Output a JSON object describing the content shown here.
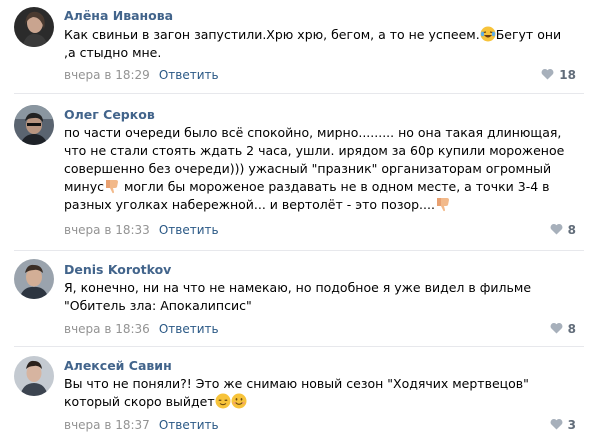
{
  "comments": [
    {
      "author": "Алёна Иванова",
      "lines": [
        "Как свиньи в загон запустили.Хрю хрю, бегом, а то не успеем.",
        "Бегут они",
        ",а стыдно мне."
      ],
      "time": "вчера в 18:29",
      "reply": "Ответить",
      "likes": "18",
      "emoji": [
        "laughing-crying"
      ]
    },
    {
      "author": "Олег Серков",
      "lines": [
        "по части очереди было всё спокойно, мирно......... но она такая длинющая,",
        "что не стали стоять ждать 2 часа, ушли. ирядом за 60р купили мороженое",
        "совершенно без очереди))) ужасный \"празник\" организаторам огромный",
        "минус",
        " могли бы мороженое раздавать не в одном месте, а точки 3-4 в",
        "разных уголках набережной... и вертолёт - это позор...."
      ],
      "time": "вчера в 18:33",
      "reply": "Ответить",
      "likes": "8",
      "emoji": [
        "thumbs-down",
        "thumbs-down"
      ]
    },
    {
      "author": "Denis Korotkov",
      "lines": [
        "Я, конечно, ни на что не намекаю, но подобное я уже видел в фильме",
        "\"Обитель зла: Апокалипсис\""
      ],
      "time": "вчера в 18:36",
      "reply": "Ответить",
      "likes": "8",
      "emoji": []
    },
    {
      "author": "Алексей Савин",
      "lines": [
        "Вы что не поняли?! Это же снимаю новый сезон \"Ходячих мертвецов\"",
        "который скоро выйдет"
      ],
      "time": "вчера в 18:37",
      "reply": "Ответить",
      "likes": "3",
      "emoji": [
        "relieved",
        "smiling"
      ]
    }
  ],
  "colors": {
    "author": "#42648b",
    "link": "#2a5885",
    "meta": "#939393",
    "heart": "#a7b0bb",
    "divider": "#e7e8ec"
  }
}
